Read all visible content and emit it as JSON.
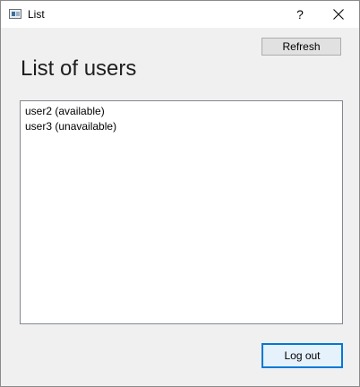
{
  "window": {
    "title": "List",
    "help_label": "?",
    "icon": "app-window-icon",
    "close_icon": "close-icon"
  },
  "toolbar": {
    "refresh_label": "Refresh"
  },
  "main": {
    "title": "List of users",
    "users": [
      "user2 (available)",
      "user3 (unavailable)"
    ]
  },
  "footer": {
    "logout_label": "Log out"
  },
  "colors": {
    "focus_border": "#0078d7",
    "dialog_background": "#f0f0f0"
  }
}
